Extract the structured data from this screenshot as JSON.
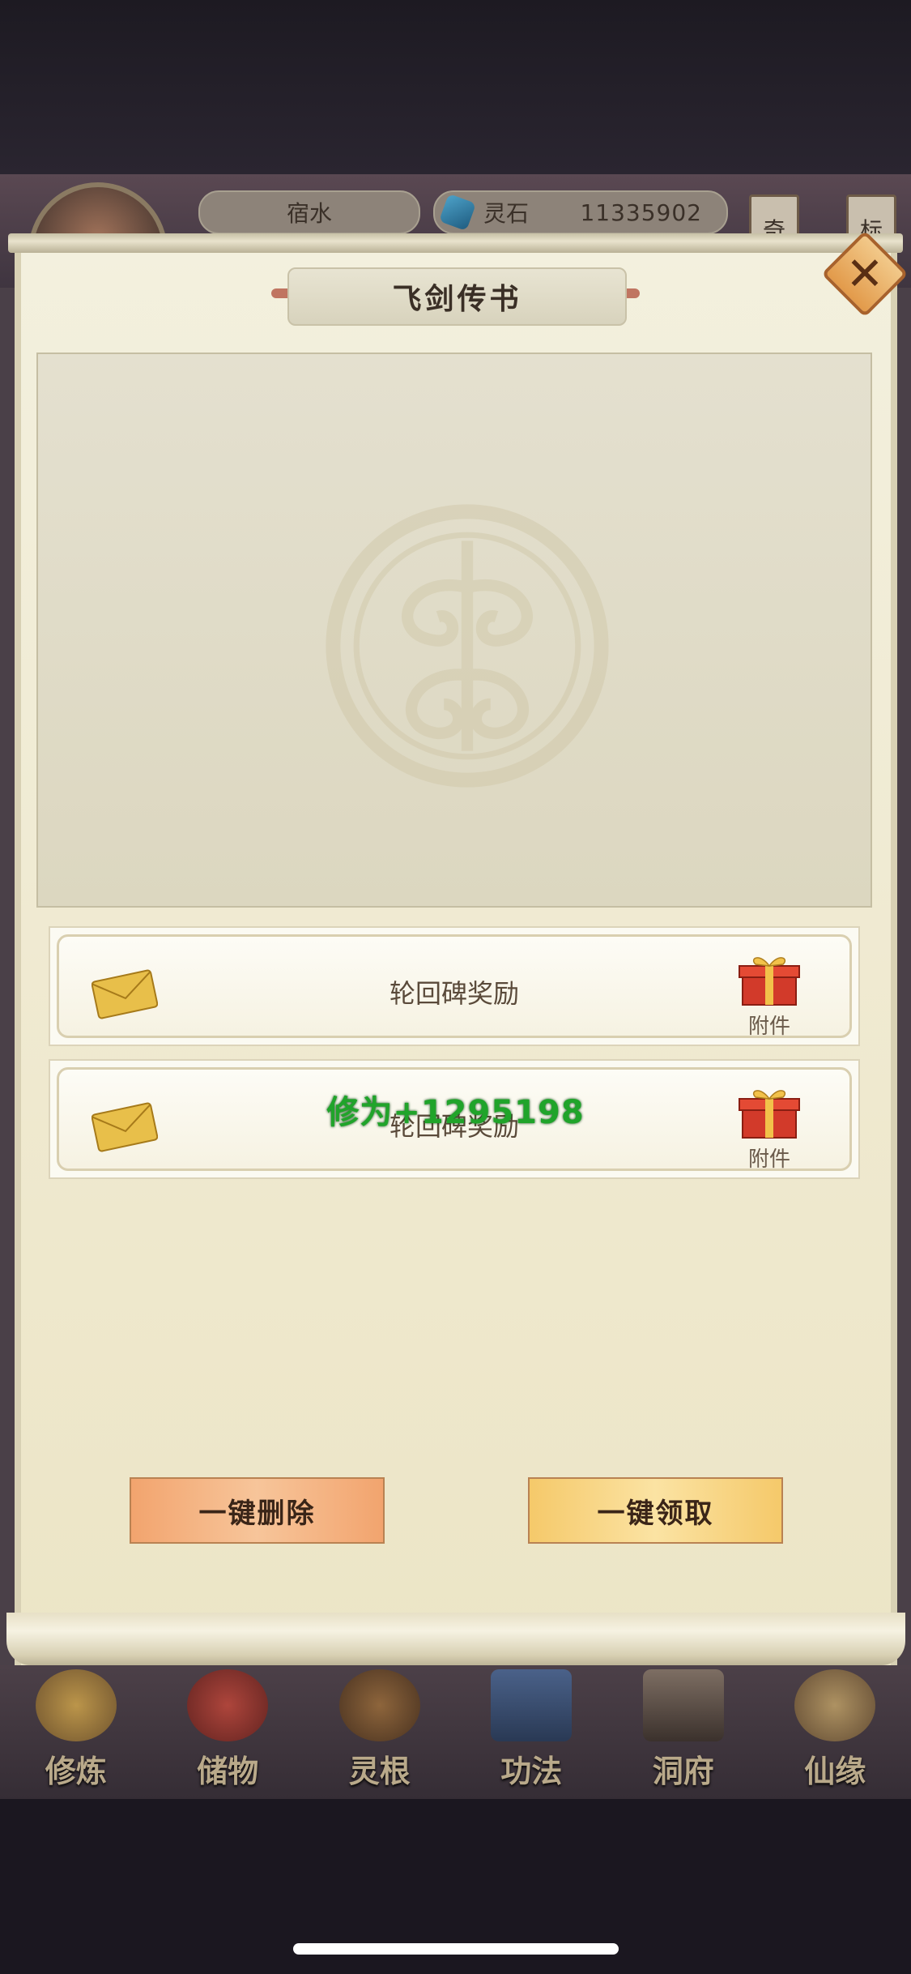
{
  "hud": {
    "player_name": "宿水",
    "currency_label": "灵石",
    "currency_value": "11335902",
    "side_tags": [
      "奇",
      "标"
    ]
  },
  "dialog": {
    "title": "飞剑传书",
    "close_icon": "close-icon"
  },
  "mails": [
    {
      "title": "轮回碑奖励",
      "attachment_label": "附件"
    },
    {
      "title": "轮回碑奖励",
      "attachment_label": "附件"
    }
  ],
  "floating_reward_text": "修为+1295198",
  "actions": {
    "delete_all": "一键删除",
    "claim_all": "一键领取"
  },
  "bottom_nav": [
    {
      "label": "修炼",
      "color": "#c99a3a"
    },
    {
      "label": "储物",
      "color": "#b23a3a"
    },
    {
      "label": "灵根",
      "color": "#8a5a2a"
    },
    {
      "label": "功法",
      "color": "#3a5a8a"
    },
    {
      "label": "洞府",
      "color": "#7a6a5a"
    },
    {
      "label": "仙缘",
      "color": "#a08a5a"
    }
  ]
}
